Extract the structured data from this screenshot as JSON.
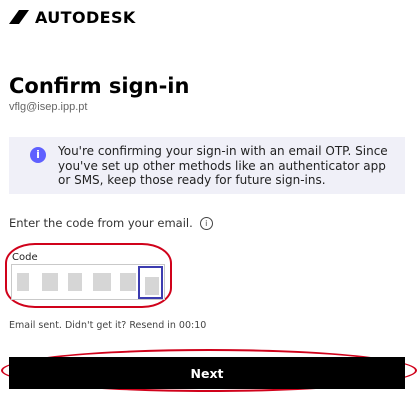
{
  "brand": {
    "name": "AUTODESK",
    "logo_icon": "autodesk-logo-mark"
  },
  "page": {
    "title": "Confirm sign-in",
    "email": "vflg@isep.ipp.pt"
  },
  "info": {
    "icon": "info-icon",
    "icon_glyph": "i",
    "text": "You're confirming your sign-in with an email OTP. Since you've set up other methods like an authenticator app or SMS, keep those ready for future sign-ins."
  },
  "code": {
    "prompt": "Enter the code from your email.",
    "help_icon_glyph": "i",
    "label": "Code",
    "digits_entered": 6
  },
  "resend": {
    "text": "Email sent. Didn't get it? Resend in 00:10"
  },
  "actions": {
    "next_label": "Next"
  },
  "colors": {
    "accent": "#5f60ff",
    "button_bg": "#000000",
    "annotation_red": "#d0021b",
    "focus_border": "#3c3cb0",
    "info_bg": "#f0f0f8"
  }
}
